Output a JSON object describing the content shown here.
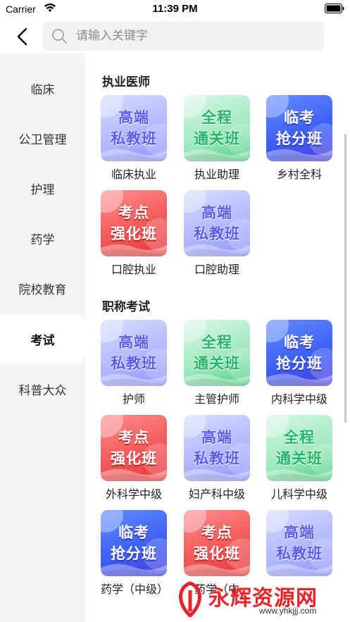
{
  "status_bar": {
    "carrier": "Carrier",
    "time": "11:39 PM"
  },
  "search": {
    "placeholder": "请输入关键字",
    "value": ""
  },
  "sidebar": {
    "items": [
      {
        "label": "临床",
        "active": false
      },
      {
        "label": "公卫管理",
        "active": false
      },
      {
        "label": "护理",
        "active": false
      },
      {
        "label": "药学",
        "active": false
      },
      {
        "label": "院校教育",
        "active": false
      },
      {
        "label": "考试",
        "active": true
      },
      {
        "label": "科普大众",
        "active": false
      }
    ]
  },
  "sections": [
    {
      "title": "执业医师",
      "cards": [
        {
          "label": "临床执业",
          "thumb_line1": "高端",
          "thumb_line2": "私教班",
          "style": "purple"
        },
        {
          "label": "执业助理",
          "thumb_line1": "全程",
          "thumb_line2": "通关班",
          "style": "green"
        },
        {
          "label": "乡村全科",
          "thumb_line1": "临考",
          "thumb_line2": "抢分班",
          "style": "blue"
        },
        {
          "label": "口腔执业",
          "thumb_line1": "考点",
          "thumb_line2": "强化班",
          "style": "red"
        },
        {
          "label": "口腔助理",
          "thumb_line1": "高端",
          "thumb_line2": "私教班",
          "style": "purple"
        }
      ]
    },
    {
      "title": "职称考试",
      "cards": [
        {
          "label": "护师",
          "thumb_line1": "高端",
          "thumb_line2": "私教班",
          "style": "purple"
        },
        {
          "label": "主管护师",
          "thumb_line1": "全程",
          "thumb_line2": "通关班",
          "style": "green"
        },
        {
          "label": "内科学中级",
          "thumb_line1": "临考",
          "thumb_line2": "抢分班",
          "style": "blue"
        },
        {
          "label": "外科学中级",
          "thumb_line1": "考点",
          "thumb_line2": "强化班",
          "style": "red"
        },
        {
          "label": "妇产科中级",
          "thumb_line1": "高端",
          "thumb_line2": "私教班",
          "style": "purple"
        },
        {
          "label": "儿科学中级",
          "thumb_line1": "全程",
          "thumb_line2": "通关班",
          "style": "green"
        },
        {
          "label": "药学（中级）",
          "thumb_line1": "临考",
          "thumb_line2": "抢分班",
          "style": "blue"
        },
        {
          "label": "药学（中",
          "thumb_line1": "考点",
          "thumb_line2": "强化班",
          "style": "red"
        },
        {
          "label": "",
          "thumb_line1": "高端",
          "thumb_line2": "私教班",
          "style": "purple"
        }
      ]
    }
  ],
  "watermark": {
    "brand": "永辉资源网",
    "url": "www.yhkjjj.com"
  },
  "colors": {
    "sidebar_bg": "#f5f5f5",
    "watermark_red": "#e8232a"
  },
  "icons": {
    "back": "chevron-left-icon",
    "search": "search-icon",
    "wifi": "wifi-icon",
    "battery": "battery-icon"
  }
}
